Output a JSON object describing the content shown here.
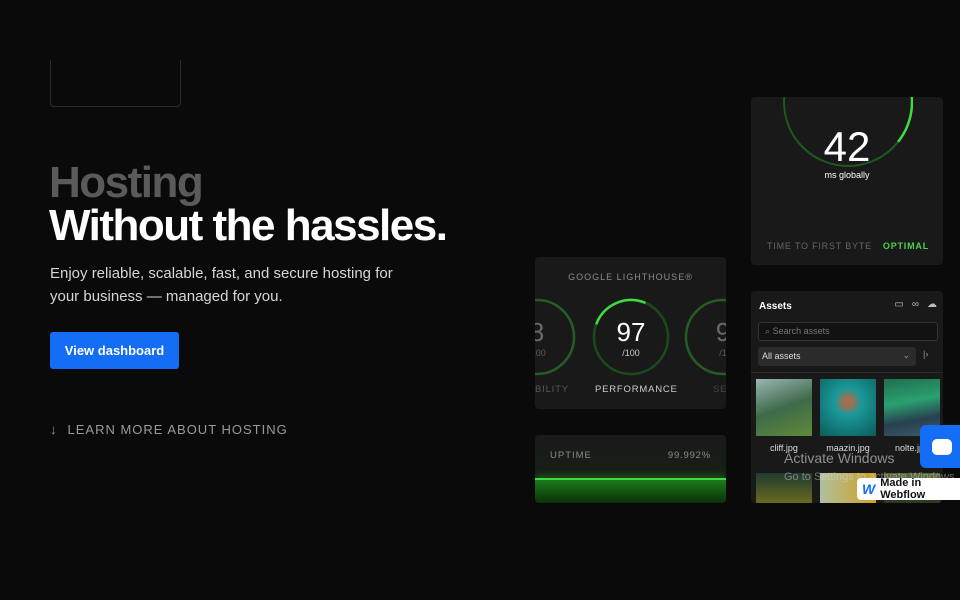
{
  "hero": {
    "title_muted": "Hosting",
    "title_main": "Without the hassles.",
    "description": "Enjoy reliable, scalable, fast, and secure hosting for your business — managed for you.",
    "cta_label": "View dashboard",
    "learn_more": "LEARN MORE ABOUT HOSTING"
  },
  "lighthouse": {
    "title": "GOOGLE LIGHTHOUSE®",
    "scores": [
      {
        "value": "8",
        "denominator": "/100",
        "label": "BILITY",
        "fraction": 0.98
      },
      {
        "value": "97",
        "denominator": "/100",
        "label": "PERFORMANCE",
        "fraction": 0.97
      },
      {
        "value": "9",
        "denominator": "/1",
        "label": "SE",
        "fraction": 0.95
      }
    ]
  },
  "uptime": {
    "label": "UPTIME",
    "value": "99.992%"
  },
  "ttfb": {
    "value": "42",
    "unit": "ms globally",
    "label": "TIME TO FIRST BYTE",
    "status": "OPTIMAL"
  },
  "assets": {
    "title": "Assets",
    "icons": [
      "folder-add-icon",
      "link-icon",
      "upload-cloud-icon"
    ],
    "search_placeholder": "Search assets",
    "filter": "All assets",
    "files": [
      "cliff.jpg",
      "maazin.jpg",
      "nolte.jpg"
    ]
  },
  "overlay": {
    "activate_title": "Activate Windows",
    "activate_sub": "Go to Settings to activate Windows.",
    "webflow_badge": "Made in Webflow",
    "webflow_logo": "W"
  },
  "colors": {
    "accent": "#146ef5",
    "success": "#3fdc3f",
    "background": "#0a0a0a"
  }
}
